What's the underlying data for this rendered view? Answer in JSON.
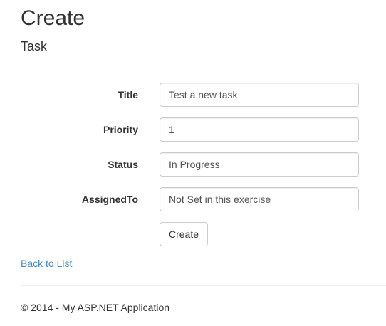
{
  "page": {
    "title": "Create",
    "subtitle": "Task"
  },
  "form": {
    "fields": [
      {
        "label": "Title",
        "value": "Test a new task"
      },
      {
        "label": "Priority",
        "value": "1"
      },
      {
        "label": "Status",
        "value": "In Progress"
      },
      {
        "label": "AssignedTo",
        "value": "Not Set in this exercise"
      }
    ],
    "submit_label": "Create"
  },
  "nav": {
    "back_label": "Back to List"
  },
  "footer": {
    "text": "© 2014 - My ASP.NET Application"
  },
  "colors": {
    "link": "#428bca",
    "text": "#333333",
    "input_border": "#cccccc"
  }
}
